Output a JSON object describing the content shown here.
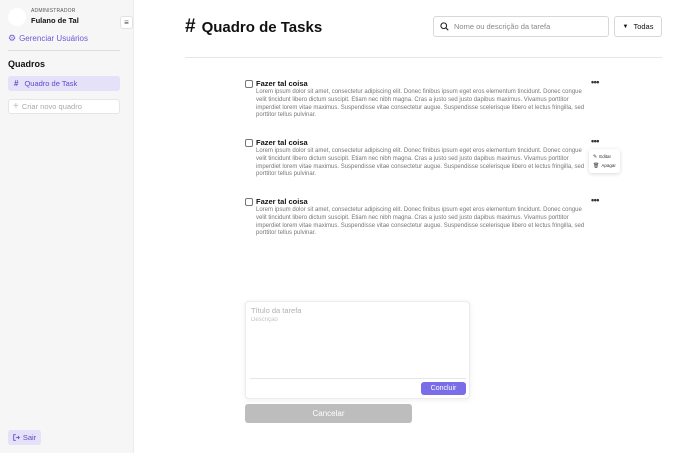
{
  "sidebar": {
    "user": {
      "role": "ADMINISTRADOR",
      "name": "Fulano de Tal"
    },
    "menu_icon": "hamburger-icon",
    "manage_users": {
      "icon": "gear-icon",
      "label": "Gerenciar Usuários"
    },
    "boards_heading": "Quadros",
    "boards": [
      {
        "icon": "#",
        "label": "Quadro de Task",
        "active": true
      }
    ],
    "new_board_placeholder": "Criar novo quadro",
    "logout": {
      "icon": "logout-icon",
      "label": "Sair"
    }
  },
  "header": {
    "icon": "#",
    "title": "Quadro de Tasks",
    "search": {
      "placeholder": "Nome ou descrição da tarefa",
      "value": ""
    },
    "filter": {
      "selected": "Todas"
    }
  },
  "tasks": [
    {
      "title": "Fazer tal coisa",
      "description": "Lorem ipsum dolor sit amet, consectetur adipiscing elit. Donec finibus ipsum eget eros elementum tincidunt. Donec congue velit tincidunt libero dictum suscipit. Etiam nec nibh magna. Cras a justo sed justo dapibus maximus. Vivamus porttitor imperdiet lorem vitae maximus. Suspendisse vitae consectetur augue. Suspendisse scelerisque libero et lectus fringilla, sed porttitor tellus pulvinar.",
      "checked": false,
      "more_label": "•••"
    },
    {
      "title": "Fazer tal coisa",
      "description": "Lorem ipsum dolor sit amet, consectetur adipiscing elit. Donec finibus ipsum eget eros elementum tincidunt. Donec congue velit tincidunt libero dictum suscipit. Etiam nec nibh magna. Cras a justo sed justo dapibus maximus. Vivamus porttitor imperdiet lorem vitae maximus. Suspendisse vitae consectetur augue. Suspendisse scelerisque libero et lectus fringilla, sed porttitor tellus pulvinar.",
      "checked": false,
      "more_label": "•••"
    },
    {
      "title": "Fazer tal coisa",
      "description": "Lorem ipsum dolor sit amet, consectetur adipiscing elit. Donec finibus ipsum eget eros elementum tincidunt. Donec congue velit tincidunt libero dictum suscipit. Etiam nec nibh magna. Cras a justo sed justo dapibus maximus. Vivamus porttitor imperdiet lorem vitae maximus. Suspendisse vitae consectetur augue. Suspendisse scelerisque libero et lectus fringilla, sed porttitor tellus pulvinar.",
      "checked": false,
      "more_label": "•••"
    }
  ],
  "task_actions": [
    {
      "icon": "pencil-icon",
      "label": "Editar"
    },
    {
      "icon": "trash-icon",
      "label": "Apagar"
    }
  ],
  "new_task": {
    "title_placeholder": "Título da tarefa",
    "description_placeholder": "Descrição",
    "submit_label": "Concluir",
    "cancel_label": "Cancelar"
  },
  "colors": {
    "accent": "#7a6de8",
    "accent_text": "#5a4bc9",
    "accent_bg": "#e4e1f8",
    "sidebar_bg": "#f6f6f7",
    "cancel_bg": "#bdbdbd"
  }
}
